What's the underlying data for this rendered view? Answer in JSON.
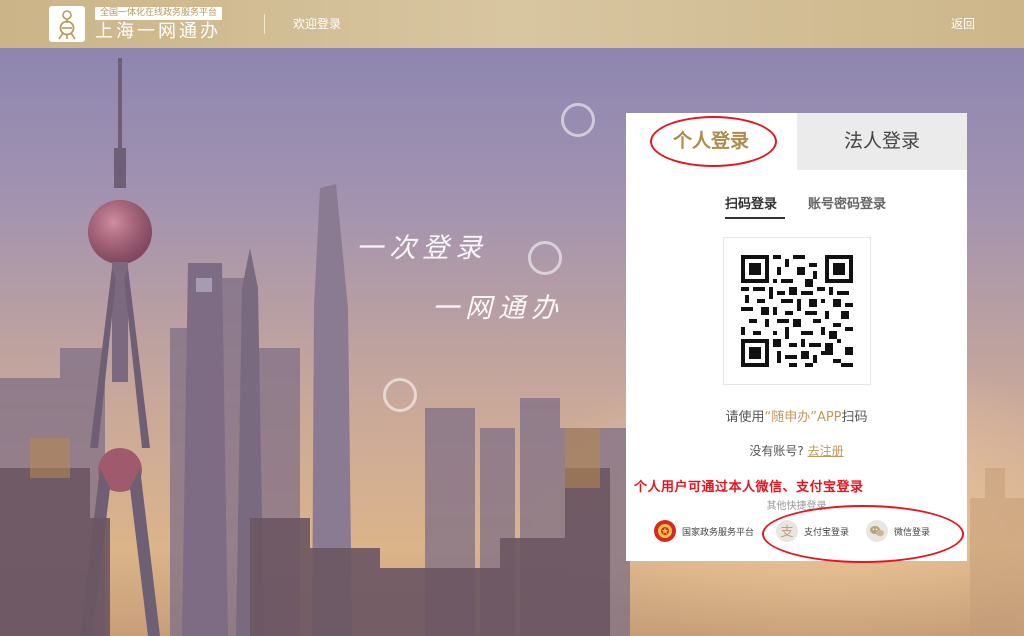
{
  "header": {
    "platform_label": "全国一体化在线政务服务平台",
    "platform_name": "上海一网通办",
    "welcome": "欢迎登录",
    "back": "返回",
    "logo_icon": "shanghai-yiwangtongban-logo"
  },
  "hero": {
    "slogan_line1": "一次登录",
    "slogan_line2": "一网通办"
  },
  "login": {
    "tabs": [
      {
        "label": "个人登录",
        "active": true
      },
      {
        "label": "法人登录",
        "active": false
      }
    ],
    "subtabs": [
      {
        "label": "扫码登录",
        "active": true
      },
      {
        "label": "账号密码登录",
        "active": false
      }
    ],
    "scan_hint_prefix": "请使用",
    "scan_hint_app": "“随申办”APP",
    "scan_hint_suffix": "扫码",
    "register_prompt": "没有账号?",
    "register_link": "去注册",
    "annotation": "个人用户可通过本人微信、支付宝登录",
    "quick_login_label": "其他快捷登录",
    "quick_login": [
      {
        "label": "国家政务服务平台",
        "icon": "national-emblem-icon"
      },
      {
        "label": "支付宝登录",
        "icon": "alipay-icon"
      },
      {
        "label": "微信登录",
        "icon": "wechat-icon"
      }
    ]
  },
  "colors": {
    "header_gold": "#cbb487",
    "accent_gold": "#c09a5a",
    "annotation_red": "#e8141e"
  }
}
